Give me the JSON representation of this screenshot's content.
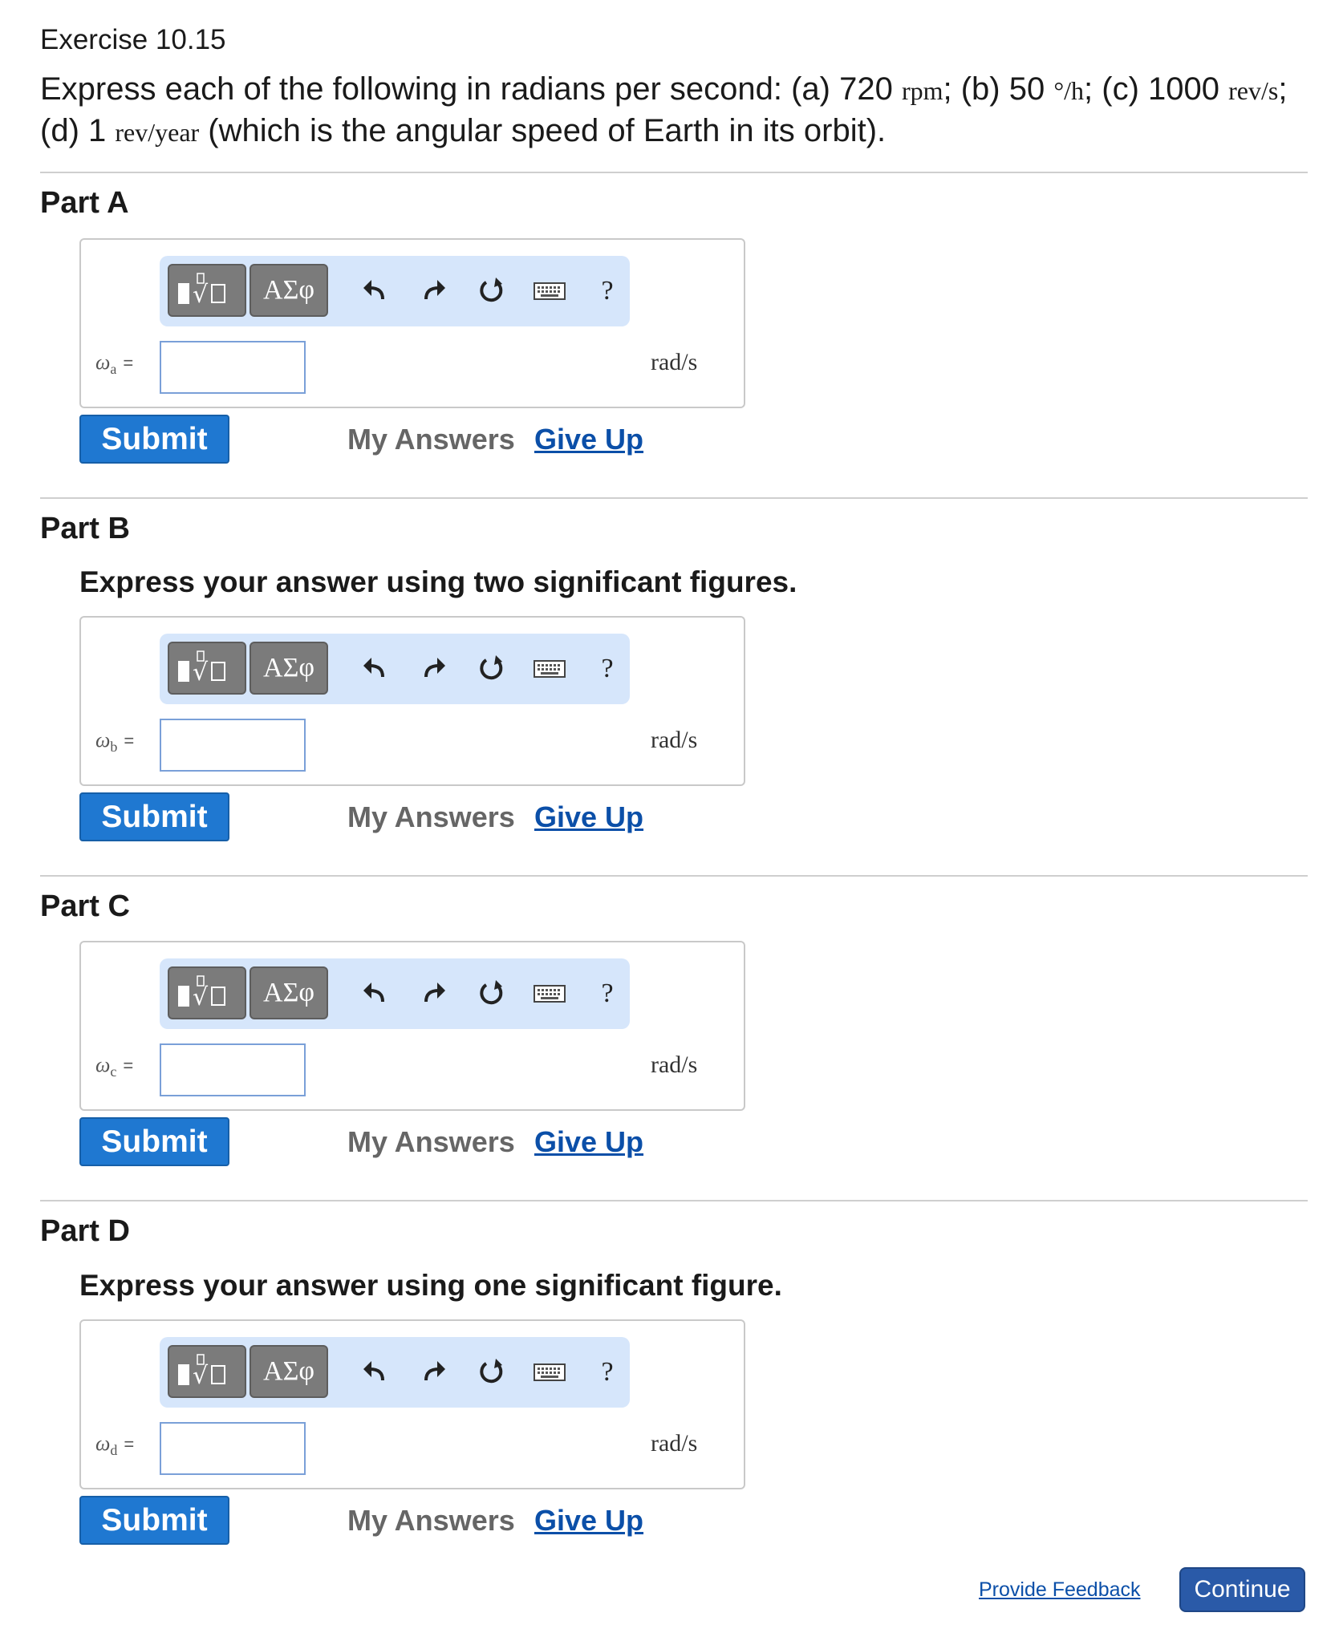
{
  "exercise_title": "Exercise 10.15",
  "problem": {
    "text_1": "Express each of the following in radians per second: (a) 720 ",
    "unit_rpm": "rpm",
    "text_2": "; (b) 50 ",
    "unit_deg_h": "°/h",
    "text_3": "; (c) 1000 ",
    "unit_rev_s": "rev/s",
    "text_4": "; (d) 1 ",
    "unit_rev_year": "rev/year",
    "text_5": " (which is the angular speed of Earth in its orbit)."
  },
  "toolbar": {
    "greek_label": "ΑΣφ",
    "help_label": "?",
    "icons": [
      "templates-icon",
      "greek-letters",
      "undo-icon",
      "redo-icon",
      "reset-icon",
      "keyboard-icon",
      "help-icon"
    ]
  },
  "parts": [
    {
      "title": "Part A",
      "instruction": "",
      "var_symbol": "ω",
      "var_sub": "a",
      "equals": "=",
      "unit": "rad/s",
      "value": ""
    },
    {
      "title": "Part B",
      "instruction": "Express your answer using two significant figures.",
      "var_symbol": "ω",
      "var_sub": "b",
      "equals": "=",
      "unit": "rad/s",
      "value": ""
    },
    {
      "title": "Part C",
      "instruction": "",
      "var_symbol": "ω",
      "var_sub": "c",
      "equals": "=",
      "unit": "rad/s",
      "value": ""
    },
    {
      "title": "Part D",
      "instruction": "Express your answer using one significant figure.",
      "var_symbol": "ω",
      "var_sub": "d",
      "equals": "=",
      "unit": "rad/s",
      "value": ""
    }
  ],
  "actions": {
    "submit_label": "Submit",
    "my_answers_label": "My Answers",
    "give_up_label": "Give Up"
  },
  "footer": {
    "feedback_label": "Provide Feedback",
    "continue_label": "Continue"
  },
  "colors": {
    "submit_blue": "#1f78d1",
    "link_blue": "#0b4fa8",
    "toolbar_bg": "#d6e6fb",
    "continue_blue": "#2a5aa8"
  }
}
